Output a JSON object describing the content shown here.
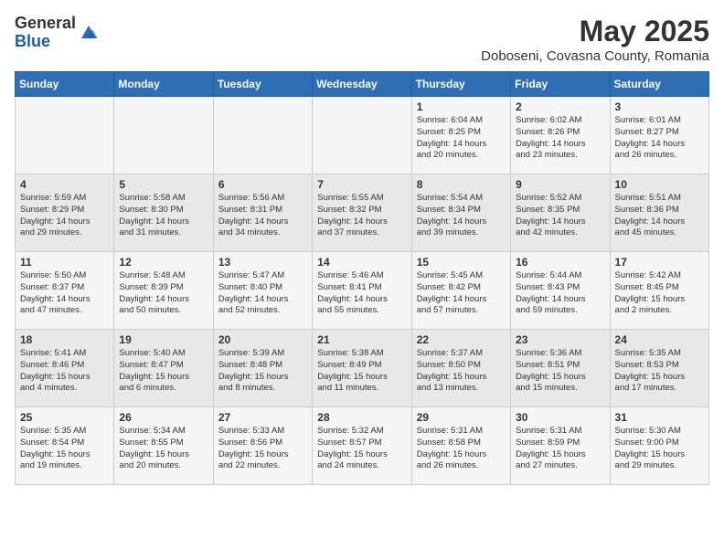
{
  "logo": {
    "general": "General",
    "blue": "Blue"
  },
  "title": "May 2025",
  "location": "Doboseni, Covasna County, Romania",
  "weekdays": [
    "Sunday",
    "Monday",
    "Tuesday",
    "Wednesday",
    "Thursday",
    "Friday",
    "Saturday"
  ],
  "weeks": [
    [
      {
        "day": "",
        "info": ""
      },
      {
        "day": "",
        "info": ""
      },
      {
        "day": "",
        "info": ""
      },
      {
        "day": "",
        "info": ""
      },
      {
        "day": "1",
        "info": "Sunrise: 6:04 AM\nSunset: 8:25 PM\nDaylight: 14 hours\nand 20 minutes."
      },
      {
        "day": "2",
        "info": "Sunrise: 6:02 AM\nSunset: 8:26 PM\nDaylight: 14 hours\nand 23 minutes."
      },
      {
        "day": "3",
        "info": "Sunrise: 6:01 AM\nSunset: 8:27 PM\nDaylight: 14 hours\nand 26 minutes."
      }
    ],
    [
      {
        "day": "4",
        "info": "Sunrise: 5:59 AM\nSunset: 8:29 PM\nDaylight: 14 hours\nand 29 minutes."
      },
      {
        "day": "5",
        "info": "Sunrise: 5:58 AM\nSunset: 8:30 PM\nDaylight: 14 hours\nand 31 minutes."
      },
      {
        "day": "6",
        "info": "Sunrise: 5:56 AM\nSunset: 8:31 PM\nDaylight: 14 hours\nand 34 minutes."
      },
      {
        "day": "7",
        "info": "Sunrise: 5:55 AM\nSunset: 8:32 PM\nDaylight: 14 hours\nand 37 minutes."
      },
      {
        "day": "8",
        "info": "Sunrise: 5:54 AM\nSunset: 8:34 PM\nDaylight: 14 hours\nand 39 minutes."
      },
      {
        "day": "9",
        "info": "Sunrise: 5:52 AM\nSunset: 8:35 PM\nDaylight: 14 hours\nand 42 minutes."
      },
      {
        "day": "10",
        "info": "Sunrise: 5:51 AM\nSunset: 8:36 PM\nDaylight: 14 hours\nand 45 minutes."
      }
    ],
    [
      {
        "day": "11",
        "info": "Sunrise: 5:50 AM\nSunset: 8:37 PM\nDaylight: 14 hours\nand 47 minutes."
      },
      {
        "day": "12",
        "info": "Sunrise: 5:48 AM\nSunset: 8:39 PM\nDaylight: 14 hours\nand 50 minutes."
      },
      {
        "day": "13",
        "info": "Sunrise: 5:47 AM\nSunset: 8:40 PM\nDaylight: 14 hours\nand 52 minutes."
      },
      {
        "day": "14",
        "info": "Sunrise: 5:46 AM\nSunset: 8:41 PM\nDaylight: 14 hours\nand 55 minutes."
      },
      {
        "day": "15",
        "info": "Sunrise: 5:45 AM\nSunset: 8:42 PM\nDaylight: 14 hours\nand 57 minutes."
      },
      {
        "day": "16",
        "info": "Sunrise: 5:44 AM\nSunset: 8:43 PM\nDaylight: 14 hours\nand 59 minutes."
      },
      {
        "day": "17",
        "info": "Sunrise: 5:42 AM\nSunset: 8:45 PM\nDaylight: 15 hours\nand 2 minutes."
      }
    ],
    [
      {
        "day": "18",
        "info": "Sunrise: 5:41 AM\nSunset: 8:46 PM\nDaylight: 15 hours\nand 4 minutes."
      },
      {
        "day": "19",
        "info": "Sunrise: 5:40 AM\nSunset: 8:47 PM\nDaylight: 15 hours\nand 6 minutes."
      },
      {
        "day": "20",
        "info": "Sunrise: 5:39 AM\nSunset: 8:48 PM\nDaylight: 15 hours\nand 8 minutes."
      },
      {
        "day": "21",
        "info": "Sunrise: 5:38 AM\nSunset: 8:49 PM\nDaylight: 15 hours\nand 11 minutes."
      },
      {
        "day": "22",
        "info": "Sunrise: 5:37 AM\nSunset: 8:50 PM\nDaylight: 15 hours\nand 13 minutes."
      },
      {
        "day": "23",
        "info": "Sunrise: 5:36 AM\nSunset: 8:51 PM\nDaylight: 15 hours\nand 15 minutes."
      },
      {
        "day": "24",
        "info": "Sunrise: 5:35 AM\nSunset: 8:53 PM\nDaylight: 15 hours\nand 17 minutes."
      }
    ],
    [
      {
        "day": "25",
        "info": "Sunrise: 5:35 AM\nSunset: 8:54 PM\nDaylight: 15 hours\nand 19 minutes."
      },
      {
        "day": "26",
        "info": "Sunrise: 5:34 AM\nSunset: 8:55 PM\nDaylight: 15 hours\nand 20 minutes."
      },
      {
        "day": "27",
        "info": "Sunrise: 5:33 AM\nSunset: 8:56 PM\nDaylight: 15 hours\nand 22 minutes."
      },
      {
        "day": "28",
        "info": "Sunrise: 5:32 AM\nSunset: 8:57 PM\nDaylight: 15 hours\nand 24 minutes."
      },
      {
        "day": "29",
        "info": "Sunrise: 5:31 AM\nSunset: 8:58 PM\nDaylight: 15 hours\nand 26 minutes."
      },
      {
        "day": "30",
        "info": "Sunrise: 5:31 AM\nSunset: 8:59 PM\nDaylight: 15 hours\nand 27 minutes."
      },
      {
        "day": "31",
        "info": "Sunrise: 5:30 AM\nSunset: 9:00 PM\nDaylight: 15 hours\nand 29 minutes."
      }
    ]
  ]
}
